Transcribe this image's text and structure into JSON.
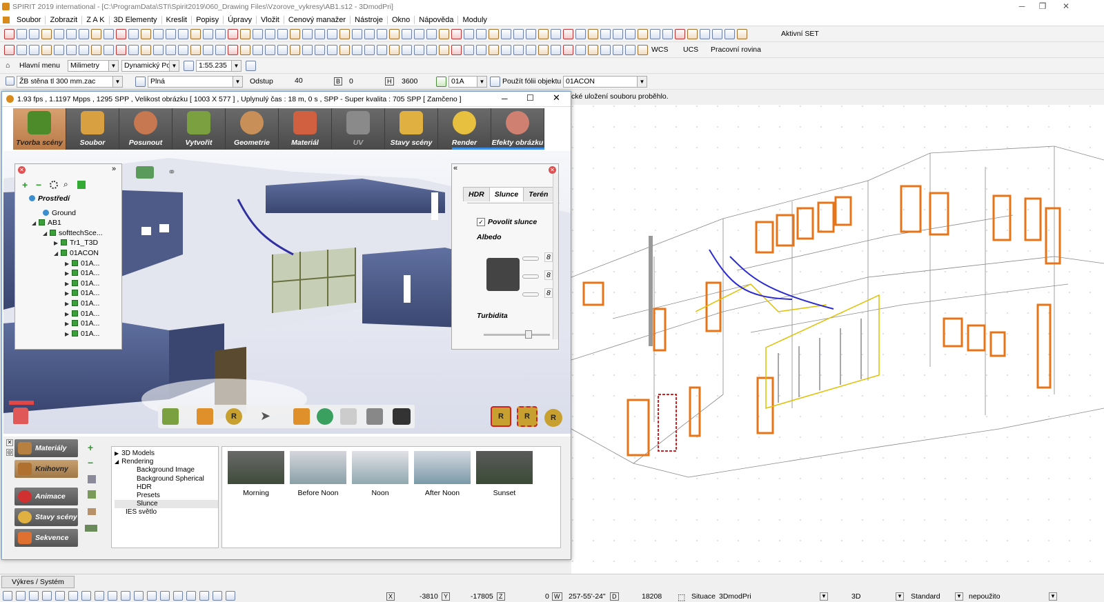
{
  "window": {
    "title": "SPIRIT 2019 international - [C:\\ProgramData\\STI\\Spirit2019\\060_Drawing Files\\Vzorove_vykresy\\AB1.s12 - 3DmodPri]"
  },
  "menu": [
    "Soubor",
    "Zobrazit",
    "Z A K",
    "3D Elementy",
    "Kreslit",
    "Popisy",
    "Úpravy",
    "Vložit",
    "Cenový manažer",
    "Nástroje",
    "Okno",
    "Nápověda",
    "Moduly"
  ],
  "toolbar1": {
    "active_set": "Aktivní SET"
  },
  "toolbar2": {
    "wcs": "WCS",
    "ucs": "UCS",
    "plane": "Pracovní rovina"
  },
  "toolbar3": {
    "main_menu": "Hlavní menu",
    "units": "Milimetry",
    "mode": "Dynamický Pol",
    "scale": "1:55.235"
  },
  "toolbar4": {
    "wall_style": "ŽB stěna tl 300 mm.zac",
    "fill": "Plná",
    "offset_label": "Odstup",
    "offset_value": "40",
    "b_value": "0",
    "h_value": "3600",
    "layer": "01A",
    "use_layer_label": "Použít fólii objektu",
    "layer_name": "01ACON"
  },
  "status_message": "cké uložení souboru proběhlo.",
  "render_window": {
    "title": "1.93 fps ,  1.1197 Mpps ,  1295 SPP  ,  Velikost obrázku [ 1003 X 577 ] ,  Uplynulý čas : 18 m, 0 s , SPP - Super kvalita : 705 SPP  [ Zamčeno ]",
    "ribbon": [
      "Tvorba scény",
      "Soubor",
      "Posunout",
      "Vytvořit",
      "Geometrie",
      "Materiál",
      "UV",
      "Stavy scény",
      "Render",
      "Efekty obrázku"
    ],
    "scene_tree": [
      "Prostředí",
      "Ground",
      "AB1",
      "softtechSce...",
      "Tr1_T3D",
      "01ACON",
      "01A...",
      "01A...",
      "01A...",
      "01A...",
      "01A...",
      "01A...",
      "01A...",
      "01A..."
    ],
    "env_tabs": [
      "HDR",
      "Slunce",
      "Terén"
    ],
    "enable_sun": "Povolit slunce",
    "albedo_label": "Albedo",
    "albedo_values": [
      "8",
      "8",
      "8"
    ],
    "turbidity_label": "Turbidita",
    "left_nav": [
      "Materiály",
      "Knihovny",
      "Animace",
      "Stavy scény",
      "Sekvence"
    ],
    "library_tree": [
      "3D Models",
      "Rendering",
      "Background Image",
      "Background Spherical",
      "HDR",
      "Presets",
      "Slunce",
      "IES světlo"
    ],
    "presets": [
      "Morning",
      "Before Noon",
      "Noon",
      "After Noon",
      "Sunset"
    ]
  },
  "statusbar": {
    "tab": "Výkres / Systém",
    "x_value": "-3810",
    "x_label": "Y",
    "y_value": "-17805",
    "y_label": "Z",
    "z_value": "0",
    "z_label": "W",
    "angle_value": "257-55'-24\"",
    "angle_label": "D",
    "d_value": "18208",
    "view_name": "Situace",
    "model": "3DmodPri",
    "view_mode": "3D",
    "style": "Standard",
    "unused": "nepoužito"
  },
  "colors": {
    "accent": "#3a8ee6",
    "ribbon_bg": "#555555",
    "active_tab": "#c58a58",
    "cad_orange": "#e8741a",
    "wall_blue": "#4b5a8a"
  }
}
